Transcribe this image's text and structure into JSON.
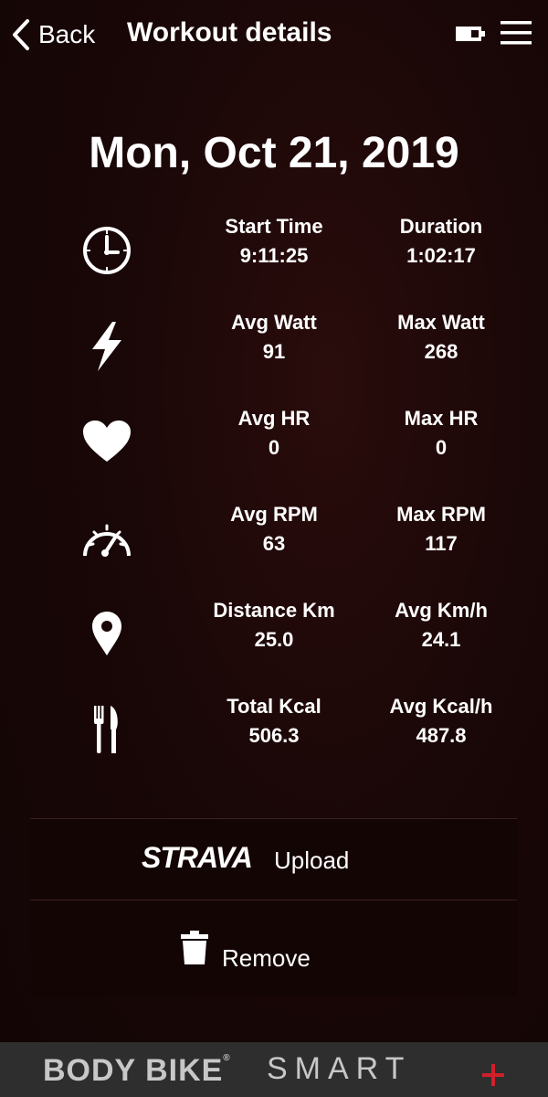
{
  "header": {
    "back_label": "Back",
    "title": "Workout details"
  },
  "date": "Mon, Oct 21, 2019",
  "stats": [
    {
      "icon": "clock-icon",
      "left_label": "Start Time",
      "left_value": "9:11:25",
      "right_label": "Duration",
      "right_value": "1:02:17"
    },
    {
      "icon": "lightning-icon",
      "left_label": "Avg Watt",
      "left_value": "91",
      "right_label": "Max Watt",
      "right_value": "268"
    },
    {
      "icon": "heart-icon",
      "left_label": "Avg HR",
      "left_value": "0",
      "right_label": "Max HR",
      "right_value": "0"
    },
    {
      "icon": "speedometer-icon",
      "left_label": "Avg RPM",
      "left_value": "63",
      "right_label": "Max RPM",
      "right_value": "117"
    },
    {
      "icon": "location-pin-icon",
      "left_label": "Distance Km",
      "left_value": "25.0",
      "right_label": "Avg Km/h",
      "right_value": "24.1"
    },
    {
      "icon": "fork-knife-icon",
      "left_label": "Total Kcal",
      "left_value": "506.3",
      "right_label": "Avg Kcal/h",
      "right_value": "487.8"
    }
  ],
  "actions": {
    "strava_logo": "STRAVA",
    "upload_label": "Upload",
    "remove_label": "Remove"
  },
  "footer": {
    "brand": "BODY BIKE",
    "brand_reg": "®",
    "product": "SMART"
  },
  "colors": {
    "background": "#1a0707",
    "footer_bg": "#2e2e2e",
    "accent_plus": "#d0202a"
  }
}
